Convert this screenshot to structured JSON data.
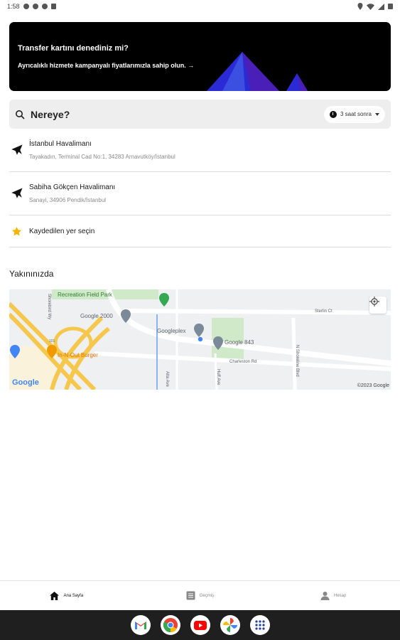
{
  "status_bar": {
    "time": "1:58"
  },
  "banner": {
    "title": "Transfer kartını denediniz mi?",
    "subtitle": "Ayrıcalıklı hizmete kampanyalı fiyatlarımızla sahip olun. →"
  },
  "search": {
    "label": "Nereye?",
    "time_chip": "3 saat sonra"
  },
  "places": [
    {
      "title": "İstanbul Havalimanı",
      "subtitle": "Tayakadın, Terminal Cad No:1, 34283 Arnavutköy/İstanbul",
      "icon": "airplane-icon"
    },
    {
      "title": "Sabiha Gökçen Havalimanı",
      "subtitle": "Sanayi, 34906 Pendik/İstanbul",
      "icon": "airplane-icon"
    }
  ],
  "saved": {
    "label": "Kaydedilen yer seçin",
    "icon": "star-icon",
    "icon_color": "#f5b400"
  },
  "nearby": {
    "title": "Yakınınızda",
    "map_labels": {
      "recreation": "Recreation Field Park",
      "google2000": "Google 2000",
      "googleplex": "Googleplex",
      "google843": "Google 843",
      "innout": "In-N-Out Burger",
      "charleston": "Charleston Rd",
      "alta": "Alta Ave",
      "huff": "Huff Ave",
      "shoreline": "N Shoreline Blvd",
      "sterlin": "Sterlin Ct",
      "shorebird": "Shorebird Wy",
      "hwy": "101"
    },
    "map_brand": "Google",
    "map_copyright": "©2023 Google"
  },
  "bottom_nav": [
    {
      "label": "Ana Sayfa",
      "icon": "home-icon",
      "active": true
    },
    {
      "label": "Geçmiş",
      "icon": "history-icon",
      "active": false
    },
    {
      "label": "Hesap",
      "icon": "account-icon",
      "active": false
    }
  ],
  "dock_apps": [
    "gmail-icon",
    "chrome-icon",
    "youtube-icon",
    "photos-icon",
    "app-drawer-icon"
  ],
  "colors": {
    "banner_bg": "#000000",
    "star": "#f5b400",
    "search_bg": "#eeeeee"
  }
}
